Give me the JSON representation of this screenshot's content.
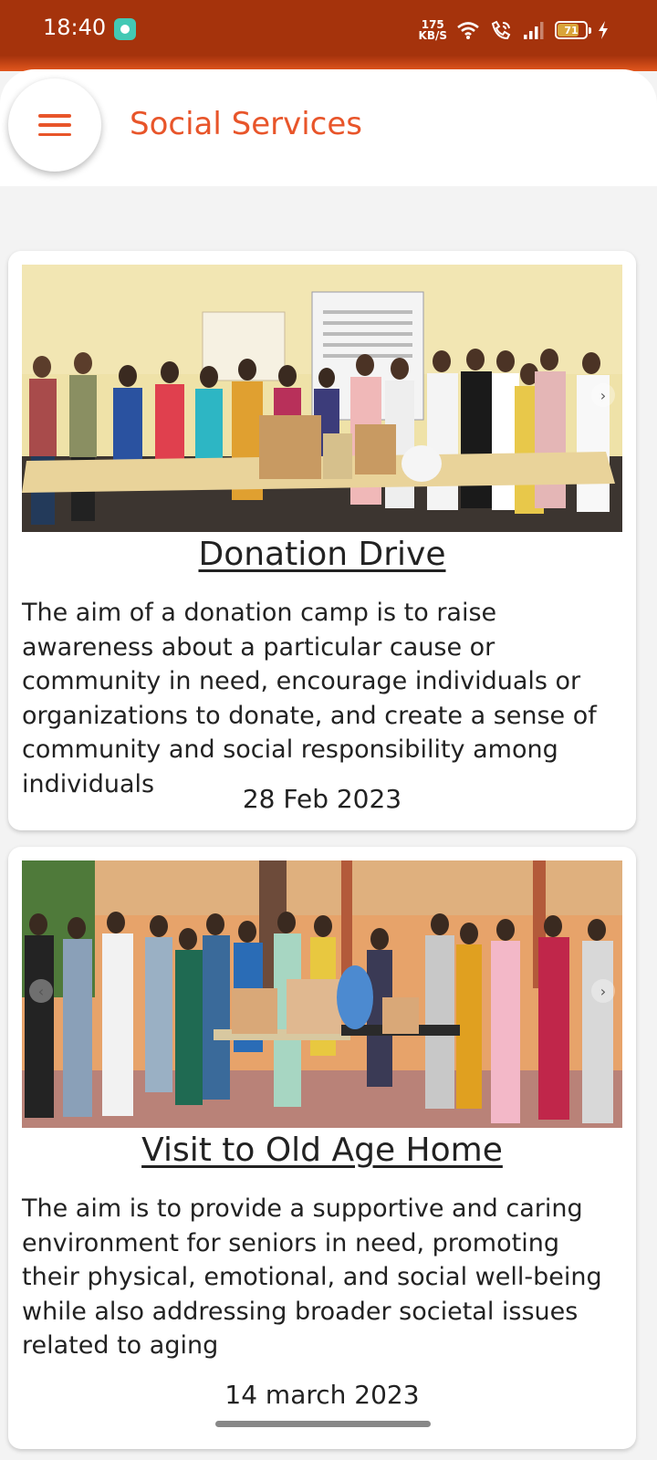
{
  "status_bar": {
    "time": "18:40",
    "net_speed_value": "175",
    "net_speed_unit": "KB/S",
    "battery_level": "71"
  },
  "app_bar": {
    "title": "Social Services",
    "menu_icon": "hamburger-menu-icon"
  },
  "colors": {
    "accent": "#e8552a",
    "status_bar": "#a5330c"
  },
  "posts": [
    {
      "title": "Donation Drive",
      "description": "The aim of a donation camp is to raise awareness about a particular cause or community in need, encourage individuals or organizations to donate, and create a sense of community and social responsibility among individuals",
      "date": "28 Feb 2023"
    },
    {
      "title": "Visit to Old Age Home",
      "description": "The aim is to provide a supportive and caring environment for seniors in need, promoting their physical, emotional, and social well-being while also addressing broader societal issues related to aging",
      "date": "14 march 2023"
    }
  ]
}
